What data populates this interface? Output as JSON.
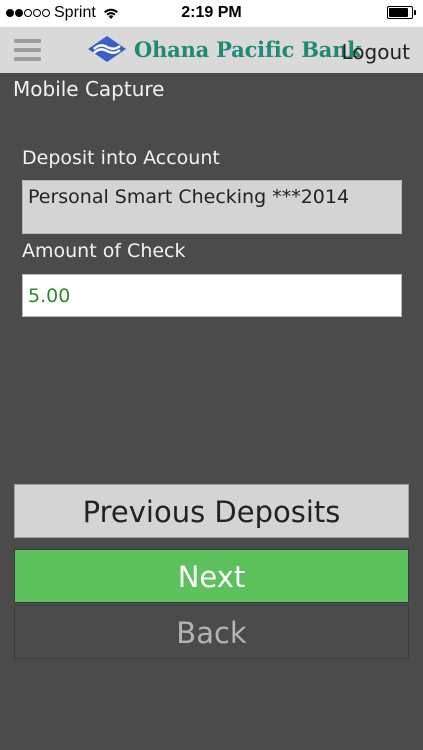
{
  "status_bar": {
    "carrier": "Sprint",
    "time": "2:19 PM",
    "signal_icon": "signal-dots-icon",
    "wifi_icon": "wifi-icon",
    "battery_icon": "battery-icon",
    "battery_level": 0.85
  },
  "header": {
    "menu_icon": "hamburger-menu-icon",
    "logo_icon": "bank-logo-icon",
    "bank_name": "Ohana Pacific Bank",
    "logout_label": "Logout",
    "brand_color": "#1f8a73"
  },
  "page": {
    "title": "Mobile Capture"
  },
  "form": {
    "account_label": "Deposit into Account",
    "account_value": "Personal Smart Checking ***2014",
    "amount_label": "Amount of Check",
    "amount_value": "5.00"
  },
  "buttons": {
    "previous_deposits": "Previous Deposits",
    "next": "Next",
    "back": "Back"
  },
  "colors": {
    "background": "#4b4b4b",
    "next_button": "#5cc05c",
    "amount_text": "#2f8a2f"
  }
}
